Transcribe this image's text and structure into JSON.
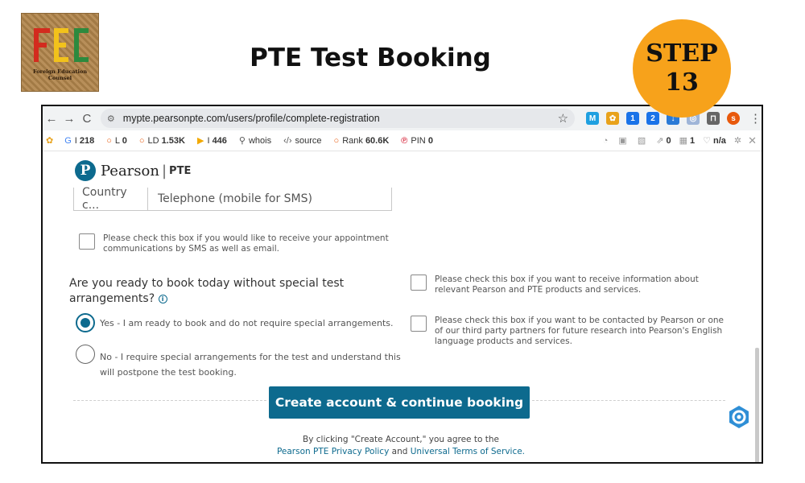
{
  "slide": {
    "logo": {
      "letters": "FEC",
      "tagline_line1": "Foreign Education",
      "tagline_line2": "Counsel"
    },
    "title": "PTE Test Booking",
    "step": {
      "label": "STEP",
      "number": "13"
    }
  },
  "browser": {
    "nav": {
      "back": "←",
      "forward": "→",
      "reload": "C"
    },
    "url": "mypte.pearsonpte.com/users/profile/complete-registration",
    "extensions": [
      {
        "glyph": "M",
        "color": "#1fa0e0"
      },
      {
        "glyph": "✿",
        "color": "#e8a21b"
      },
      {
        "glyph": "1",
        "color": "#1a73e8"
      },
      {
        "glyph": "2",
        "color": "#1a73e8"
      },
      {
        "glyph": "↓",
        "color": "#2a7ad6"
      },
      {
        "glyph": "◎",
        "color": "#9fb5d8"
      },
      {
        "glyph": "⊓",
        "color": "#666666"
      },
      {
        "glyph": "s",
        "color": "#e8590c"
      }
    ]
  },
  "seo_toolbar": {
    "items": [
      {
        "icon": "G",
        "label": "I",
        "value": "218",
        "icon_color": "#4285f4"
      },
      {
        "icon": "○",
        "label": "L",
        "value": "0",
        "icon_color": "#e8590c"
      },
      {
        "icon": "○",
        "label": "LD",
        "value": "1.53K",
        "icon_color": "#e8590c"
      },
      {
        "icon": "▶",
        "label": "I",
        "value": "446",
        "icon_color": "#f2a900"
      },
      {
        "icon": "⚲",
        "label": "whois",
        "value": "",
        "icon_color": "#555555"
      },
      {
        "icon": "‹/›",
        "label": "source",
        "value": "",
        "icon_color": "#555555"
      },
      {
        "icon": "○",
        "label": "Rank",
        "value": "60.6K",
        "icon_color": "#e8590c"
      },
      {
        "icon": "℗",
        "label": "PIN",
        "value": "0",
        "icon_color": "#d0021b"
      }
    ],
    "right_items": [
      {
        "icon": "◔",
        "value": ""
      },
      {
        "icon": "▣",
        "value": ""
      },
      {
        "icon": "▧",
        "value": ""
      },
      {
        "icon": "⇗",
        "value": "0"
      },
      {
        "icon": "▦",
        "value": "1"
      },
      {
        "icon": "♡",
        "value": "n/a"
      }
    ]
  },
  "page": {
    "brand": {
      "name": "Pearson",
      "separator": "|",
      "product": "PTE"
    },
    "phone": {
      "country_code_placeholder": "Country c...",
      "telephone_placeholder": "Telephone (mobile for SMS)"
    },
    "sms_consent": {
      "line1": "Please check this box if you would like to receive your appointment",
      "line2": "communications by SMS as well as email."
    },
    "question": {
      "line1": "Are you ready to book today without special test",
      "line2": "arrangements?",
      "info": "i"
    },
    "options": [
      {
        "line1": "Yes - I am ready to book and do not require special arrangements.",
        "line2": "",
        "selected": true
      },
      {
        "line1": "No - I require special arrangements for the test and understand this",
        "line2": "will postpone the test booking.",
        "selected": false
      }
    ],
    "marketing_consent": {
      "line1": "Please check this box if you want to receive information about",
      "line2": "relevant Pearson and PTE products and services."
    },
    "research_consent": {
      "line1": "Please check this box if you want to be contacted by Pearson or one",
      "line2": "of our third party partners for future research into Pearson's English",
      "line3": "language products and services."
    },
    "cta_label": "Create account & continue booking",
    "legal": {
      "line1": "By clicking \"Create Account,\" you agree to the",
      "privacy_link": "Pearson PTE Privacy Policy",
      "and": "and",
      "terms_link": "Universal Terms of Service."
    }
  },
  "colors": {
    "pearson_blue": "#0d6a8e",
    "badge_orange": "#f7a21b",
    "logo_red": "#d32b1e",
    "logo_yellow": "#f2c21b",
    "logo_green": "#2d8a3e"
  }
}
